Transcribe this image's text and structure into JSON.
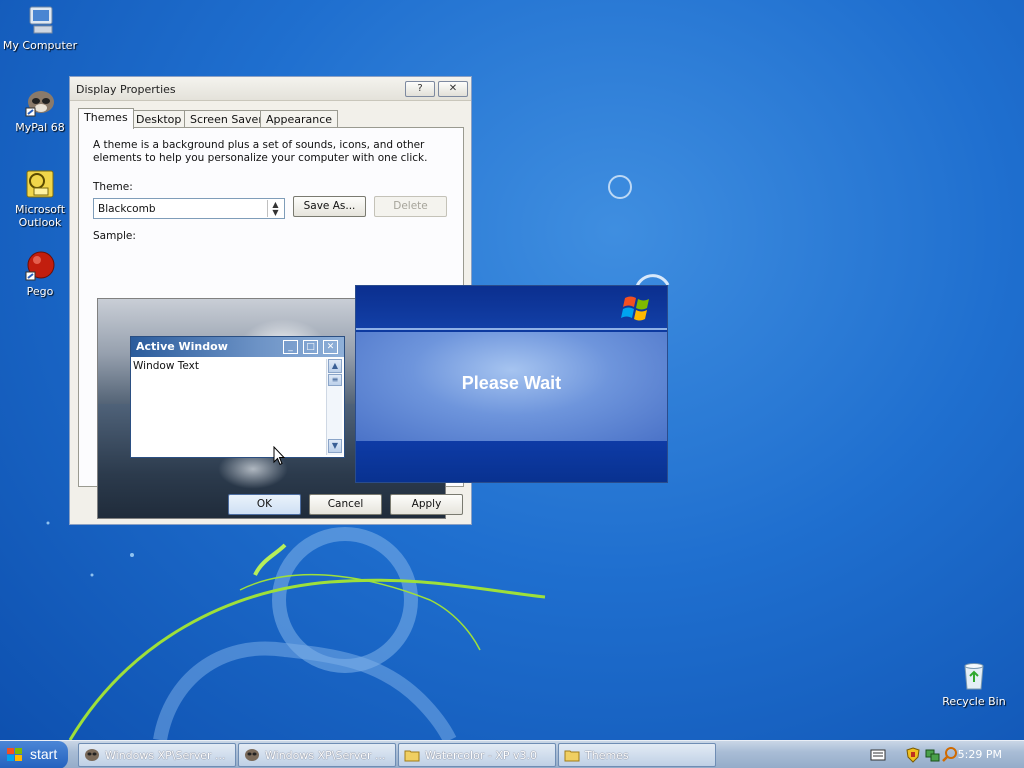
{
  "desktop": {
    "icons": [
      {
        "label": "My Computer",
        "icon": "my-computer-icon"
      },
      {
        "label": "MyPal 68",
        "icon": "mypal-icon"
      },
      {
        "label": "Microsoft Outlook",
        "icon": "outlook-icon"
      },
      {
        "label": "Pego",
        "icon": "pego-icon"
      },
      {
        "label": "Recycle Bin",
        "icon": "recycle-bin-icon"
      }
    ]
  },
  "dialog": {
    "title": "Display Properties",
    "help_glyph": "?",
    "close_glyph": "✕",
    "tabs": [
      "Themes",
      "Desktop",
      "Screen Saver",
      "Appearance"
    ],
    "active_tab": "Themes",
    "description": "A theme is a background plus a set of sounds, icons, and other elements to help you personalize your computer with one click.",
    "theme_label": "Theme:",
    "theme_value": "Blackcomb",
    "save_as": "Save As...",
    "delete": "Delete",
    "sample_label": "Sample:",
    "sample_window": {
      "title": "Active Window",
      "text": "Window Text"
    },
    "ok": "OK",
    "cancel": "Cancel",
    "apply": "Apply"
  },
  "wait_dialog": {
    "message": "Please Wait"
  },
  "taskbar": {
    "start": "start",
    "tasks": [
      {
        "label": "Windows XP\\Server ...",
        "icon": "xp-window-icon"
      },
      {
        "label": "Windows XP\\Server ...",
        "icon": "xp-window-icon"
      },
      {
        "label": "Watercolor - XP v3.0",
        "icon": "folder-icon"
      },
      {
        "label": "Themes",
        "icon": "folder-icon"
      }
    ],
    "clock": "5:29 PM"
  },
  "colors": {
    "desktop": "#1f6fcf",
    "taskbar": "#a9bdd6",
    "wait_panel": "#0d3aa0"
  }
}
